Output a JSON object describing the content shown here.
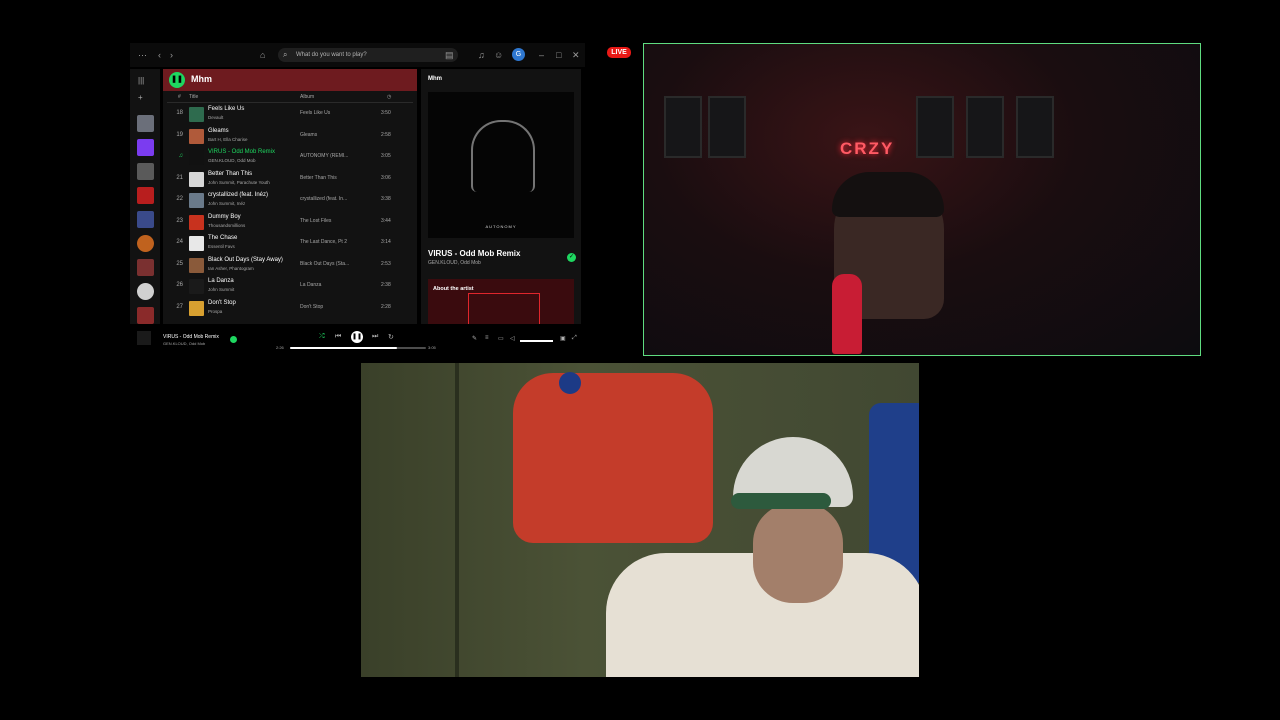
{
  "spotify": {
    "search_placeholder": "What do you want to play?",
    "avatar_letter": "G",
    "playlist": {
      "title": "Mhm",
      "col_number": "#",
      "col_title": "Title",
      "col_album": "Album",
      "col_duration_icon": "◷",
      "rows": [
        {
          "n": "18",
          "title": "Feels Like Us",
          "artist": "Devault",
          "album": "Feels Like Us",
          "dur": "3:50",
          "color": "#2e6b4e"
        },
        {
          "n": "19",
          "title": "Gleams",
          "artist": "Bart H, Ella Charise",
          "album": "Gleams",
          "dur": "2:58",
          "color": "#b05a3a"
        },
        {
          "n": "♫",
          "title": "VIRUS - Odd Mob Remix",
          "artist": "GEN.KLOUD, Odd Mob",
          "album": "AUTONOMY (REMI...",
          "dur": "3:05",
          "color": "#111111",
          "active": true
        },
        {
          "n": "21",
          "title": "Better Than This",
          "artist": "John Summit, Parachute Youth",
          "album": "Better Than This",
          "dur": "3:06",
          "color": "#d7d7d7"
        },
        {
          "n": "22",
          "title": "crystallized (feat. Inéz)",
          "artist": "John Summit, Inéz",
          "album": "crystallized (feat. In...",
          "dur": "3:38",
          "color": "#6a7a8a"
        },
        {
          "n": "23",
          "title": "Dummy Boy",
          "artist": "Thousandsmillions",
          "album": "The Lost Files",
          "dur": "3:44",
          "color": "#c8321e"
        },
        {
          "n": "24",
          "title": "The Chase",
          "artist": "Essentil Favs",
          "album": "The Last Dance, Pt 2",
          "dur": "3:14",
          "color": "#e8e8e8"
        },
        {
          "n": "25",
          "title": "Black Out Days (Stay Away)",
          "artist": "Ian Asher, Phantogram",
          "album": "Black Out Days (Sta...",
          "dur": "2:53",
          "color": "#8a5a3a"
        },
        {
          "n": "26",
          "title": "La Danza",
          "artist": "John Summit",
          "album": "La Danza",
          "dur": "2:38",
          "color": "#1a1a1a"
        },
        {
          "n": "27",
          "title": "Don't Stop",
          "artist": "Prospa",
          "album": "Don't Stop",
          "dur": "2:28",
          "color": "#d8a030"
        }
      ]
    },
    "now_playing": {
      "panel_label": "Mhm",
      "cover_text": "AUTONOMY",
      "track": "VIRUS - Odd Mob Remix",
      "artist": "GEN.KLOUD, Odd Mob",
      "about_label": "About the artist"
    },
    "player": {
      "track": "VIRUS - Odd Mob Remix",
      "artist": "GEN.KLOUD, Odd Mob",
      "elapsed": "2:26",
      "total": "3:05",
      "progress": 0.79,
      "volume": 1.0
    }
  },
  "stream": {
    "live_badge": "LIVE",
    "neon_sign": "CRZY",
    "accent": "#5fdc80",
    "live_color": "#e91916"
  }
}
